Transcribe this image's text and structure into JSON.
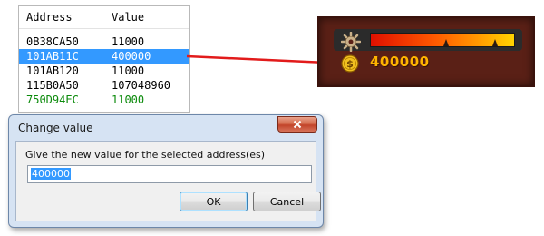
{
  "memory_list": {
    "columns": {
      "address": "Address",
      "value": "Value"
    },
    "rows": [
      {
        "address": "0B38CA50",
        "value": "11000",
        "selected": false,
        "changed": false
      },
      {
        "address": "101AB11C",
        "value": "400000",
        "selected": true,
        "changed": false
      },
      {
        "address": "101AB120",
        "value": "11000",
        "selected": false,
        "changed": false
      },
      {
        "address": "115B0A50",
        "value": "107048960",
        "selected": false,
        "changed": false
      },
      {
        "address": "750D94EC",
        "value": "11000",
        "selected": false,
        "changed": true
      }
    ]
  },
  "hud": {
    "gold_value": "400000",
    "icons": {
      "resource": "gear-icon",
      "currency": "gold-coin-icon"
    },
    "colors": {
      "gold_text": "#ffb400",
      "panel": "#5a2016"
    }
  },
  "dialog": {
    "title": "Change value",
    "prompt": "Give the new value for the selected address(es)",
    "input_value": "400000",
    "ok_label": "OK",
    "cancel_label": "Cancel"
  },
  "colors": {
    "selection": "#3399ff",
    "changed_value": "#0a8a0a",
    "arrow": "#e21b1b"
  }
}
